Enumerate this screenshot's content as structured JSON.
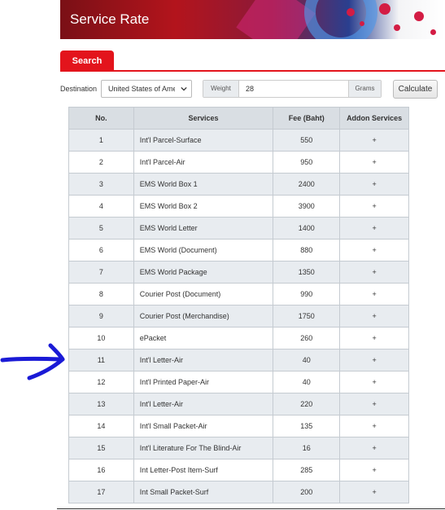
{
  "banner": {
    "title": "Service Rate"
  },
  "tabs": [
    {
      "label": "Search"
    }
  ],
  "form": {
    "destination_label": "Destination",
    "destination_value": "United States of America",
    "weight_label": "Weight",
    "weight_value": "28",
    "weight_unit": "Grams",
    "calculate_label": "Calculate"
  },
  "table": {
    "headers": [
      "No.",
      "Services",
      "Fee (Baht)",
      "Addon Services"
    ],
    "rows": [
      {
        "no": "1",
        "service": "Int'l Parcel-Surface",
        "fee": "550",
        "addon": "+"
      },
      {
        "no": "2",
        "service": "Int'l Parcel-Air",
        "fee": "950",
        "addon": "+"
      },
      {
        "no": "3",
        "service": "EMS World Box 1",
        "fee": "2400",
        "addon": "+"
      },
      {
        "no": "4",
        "service": "EMS World Box 2",
        "fee": "3900",
        "addon": "+"
      },
      {
        "no": "5",
        "service": "EMS World Letter",
        "fee": "1400",
        "addon": "+"
      },
      {
        "no": "6",
        "service": "EMS World (Document)",
        "fee": "880",
        "addon": "+"
      },
      {
        "no": "7",
        "service": "EMS World Package",
        "fee": "1350",
        "addon": "+"
      },
      {
        "no": "8",
        "service": "Courier Post (Document)",
        "fee": "990",
        "addon": "+"
      },
      {
        "no": "9",
        "service": "Courier Post (Merchandise)",
        "fee": "1750",
        "addon": "+"
      },
      {
        "no": "10",
        "service": "ePacket",
        "fee": "260",
        "addon": "+"
      },
      {
        "no": "11",
        "service": "Int'l Letter-Air",
        "fee": "40",
        "addon": "+"
      },
      {
        "no": "12",
        "service": "Int'l Printed Paper-Air",
        "fee": "40",
        "addon": "+"
      },
      {
        "no": "13",
        "service": "Int'l Letter-Air",
        "fee": "220",
        "addon": "+"
      },
      {
        "no": "14",
        "service": "Int'l Small Packet-Air",
        "fee": "135",
        "addon": "+"
      },
      {
        "no": "15",
        "service": "Int'l Literature For The Blind-Air",
        "fee": "16",
        "addon": "+"
      },
      {
        "no": "16",
        "service": "Int Letter-Post Item-Surf",
        "fee": "285",
        "addon": "+"
      },
      {
        "no": "17",
        "service": "Int Small Packet-Surf",
        "fee": "200",
        "addon": "+"
      }
    ]
  },
  "colors": {
    "accent_red": "#e3141c",
    "annotation_blue": "#1a1ad6",
    "row_alt": "#e8ecf0"
  },
  "icons": {
    "select_chevron": "chevron-down-icon",
    "annotation": "hand-drawn-arrow-icon"
  }
}
